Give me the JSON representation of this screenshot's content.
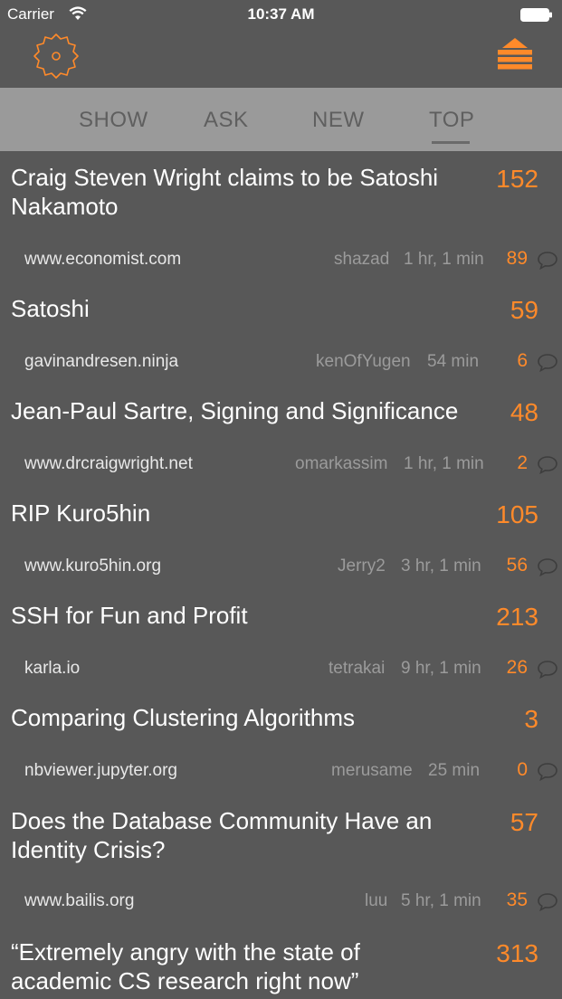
{
  "status_bar": {
    "carrier": "Carrier",
    "time": "10:37 AM"
  },
  "tabs": [
    {
      "label": "SHOW"
    },
    {
      "label": "ASK"
    },
    {
      "label": "NEW"
    },
    {
      "label": "TOP",
      "selected": true
    }
  ],
  "colors": {
    "accent": "#ff8a2a",
    "background": "#585858",
    "tab_bar": "#9a9a9a"
  },
  "stories": [
    {
      "title": "Craig Steven Wright claims to be Satoshi Nakamoto",
      "score": "152",
      "domain": "www.economist.com",
      "user": "shazad",
      "age": "1 hr, 1 min",
      "comments": "89"
    },
    {
      "title": "Satoshi",
      "score": "59",
      "domain": "gavinandresen.ninja",
      "user": "kenOfYugen",
      "age": "54 min",
      "comments": "6"
    },
    {
      "title": "Jean-Paul Sartre, Signing and Significance",
      "score": "48",
      "domain": "www.drcraigwright.net",
      "user": "omarkassim",
      "age": "1 hr, 1 min",
      "comments": "2"
    },
    {
      "title": "RIP Kuro5hin",
      "score": "105",
      "domain": "www.kuro5hin.org",
      "user": "Jerry2",
      "age": "3 hr, 1 min",
      "comments": "56"
    },
    {
      "title": "SSH for Fun and Profit",
      "score": "213",
      "domain": "karla.io",
      "user": "tetrakai",
      "age": "9 hr, 1 min",
      "comments": "26"
    },
    {
      "title": "Comparing Clustering Algorithms",
      "score": "3",
      "domain": "nbviewer.jupyter.org",
      "user": "merusame",
      "age": "25 min",
      "comments": "0"
    },
    {
      "title": "Does the Database Community Have an Identity Crisis?",
      "score": "57",
      "domain": "www.bailis.org",
      "user": "luu",
      "age": "5 hr, 1 min",
      "comments": "35"
    },
    {
      "title": "“Extremely angry with the state of academic CS research right now”",
      "score": "313"
    }
  ]
}
